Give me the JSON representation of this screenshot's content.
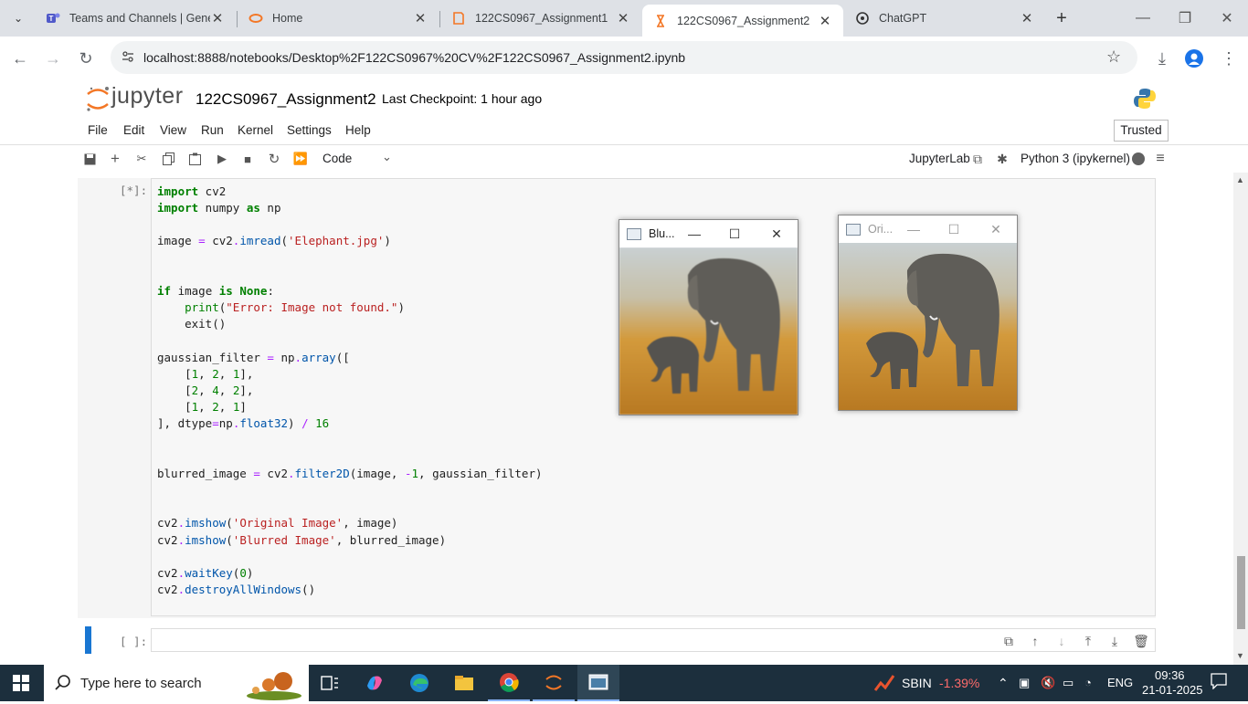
{
  "browser": {
    "tabs": [
      {
        "label": "Teams and Channels | Gene",
        "icon": "teams-icon"
      },
      {
        "label": "Home",
        "icon": "jupyter-icon"
      },
      {
        "label": "122CS0967_Assignment1",
        "icon": "jupyter-book-icon"
      },
      {
        "label": "122CS0967_Assignment2",
        "icon": "hourglass-icon"
      },
      {
        "label": "ChatGPT",
        "icon": "chatgpt-icon"
      }
    ],
    "url": "localhost:8888/notebooks/Desktop%2F122CS0967%20CV%2F122CS0967_Assignment2.ipynb"
  },
  "jupyter": {
    "logo_text": "jupyter",
    "notebook_name": "122CS0967_Assignment2",
    "checkpoint": "Last Checkpoint: 1 hour ago",
    "menu": [
      "File",
      "Edit",
      "View",
      "Run",
      "Kernel",
      "Settings",
      "Help"
    ],
    "trusted": "Trusted",
    "cell_type": "Code",
    "jupyterlab_link": "JupyterLab",
    "kernel": "Python 3 (ipykernel)"
  },
  "cells": {
    "cell1_prompt": "[*]:",
    "cell2_prompt": "[ ]:"
  },
  "cv_windows": {
    "blurred_title": "Blu...",
    "original_title": "Ori..."
  },
  "taskbar": {
    "search_placeholder": "Type here to search",
    "stock_name": "SBIN",
    "stock_change": "-1.39%",
    "lang": "ENG",
    "time": "09:36",
    "date": "21-01-2025"
  },
  "colors": {
    "jupyter_orange": "#f37726",
    "taskbar_bg": "#1c2f3d",
    "stock_red": "#ff6b6b",
    "active_cell_bar": "#1976d2"
  }
}
